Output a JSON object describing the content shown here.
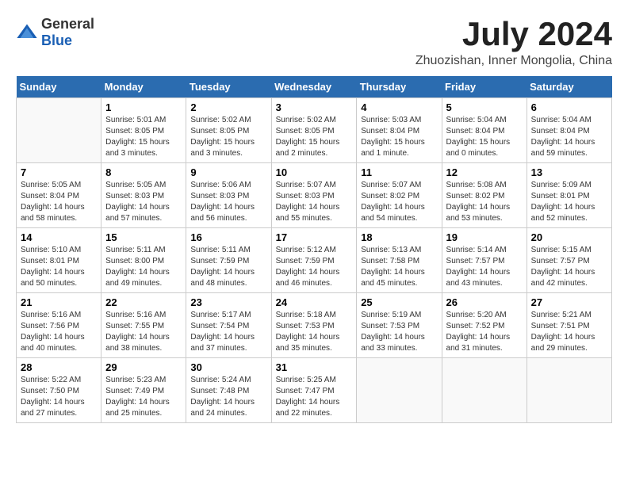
{
  "header": {
    "logo_general": "General",
    "logo_blue": "Blue",
    "month": "July 2024",
    "location": "Zhuozishan, Inner Mongolia, China"
  },
  "weekdays": [
    "Sunday",
    "Monday",
    "Tuesday",
    "Wednesday",
    "Thursday",
    "Friday",
    "Saturday"
  ],
  "weeks": [
    [
      {
        "day": "",
        "info": ""
      },
      {
        "day": "1",
        "info": "Sunrise: 5:01 AM\nSunset: 8:05 PM\nDaylight: 15 hours\nand 3 minutes."
      },
      {
        "day": "2",
        "info": "Sunrise: 5:02 AM\nSunset: 8:05 PM\nDaylight: 15 hours\nand 3 minutes."
      },
      {
        "day": "3",
        "info": "Sunrise: 5:02 AM\nSunset: 8:05 PM\nDaylight: 15 hours\nand 2 minutes."
      },
      {
        "day": "4",
        "info": "Sunrise: 5:03 AM\nSunset: 8:04 PM\nDaylight: 15 hours\nand 1 minute."
      },
      {
        "day": "5",
        "info": "Sunrise: 5:04 AM\nSunset: 8:04 PM\nDaylight: 15 hours\nand 0 minutes."
      },
      {
        "day": "6",
        "info": "Sunrise: 5:04 AM\nSunset: 8:04 PM\nDaylight: 14 hours\nand 59 minutes."
      }
    ],
    [
      {
        "day": "7",
        "info": "Sunrise: 5:05 AM\nSunset: 8:04 PM\nDaylight: 14 hours\nand 58 minutes."
      },
      {
        "day": "8",
        "info": "Sunrise: 5:05 AM\nSunset: 8:03 PM\nDaylight: 14 hours\nand 57 minutes."
      },
      {
        "day": "9",
        "info": "Sunrise: 5:06 AM\nSunset: 8:03 PM\nDaylight: 14 hours\nand 56 minutes."
      },
      {
        "day": "10",
        "info": "Sunrise: 5:07 AM\nSunset: 8:03 PM\nDaylight: 14 hours\nand 55 minutes."
      },
      {
        "day": "11",
        "info": "Sunrise: 5:07 AM\nSunset: 8:02 PM\nDaylight: 14 hours\nand 54 minutes."
      },
      {
        "day": "12",
        "info": "Sunrise: 5:08 AM\nSunset: 8:02 PM\nDaylight: 14 hours\nand 53 minutes."
      },
      {
        "day": "13",
        "info": "Sunrise: 5:09 AM\nSunset: 8:01 PM\nDaylight: 14 hours\nand 52 minutes."
      }
    ],
    [
      {
        "day": "14",
        "info": "Sunrise: 5:10 AM\nSunset: 8:01 PM\nDaylight: 14 hours\nand 50 minutes."
      },
      {
        "day": "15",
        "info": "Sunrise: 5:11 AM\nSunset: 8:00 PM\nDaylight: 14 hours\nand 49 minutes."
      },
      {
        "day": "16",
        "info": "Sunrise: 5:11 AM\nSunset: 7:59 PM\nDaylight: 14 hours\nand 48 minutes."
      },
      {
        "day": "17",
        "info": "Sunrise: 5:12 AM\nSunset: 7:59 PM\nDaylight: 14 hours\nand 46 minutes."
      },
      {
        "day": "18",
        "info": "Sunrise: 5:13 AM\nSunset: 7:58 PM\nDaylight: 14 hours\nand 45 minutes."
      },
      {
        "day": "19",
        "info": "Sunrise: 5:14 AM\nSunset: 7:57 PM\nDaylight: 14 hours\nand 43 minutes."
      },
      {
        "day": "20",
        "info": "Sunrise: 5:15 AM\nSunset: 7:57 PM\nDaylight: 14 hours\nand 42 minutes."
      }
    ],
    [
      {
        "day": "21",
        "info": "Sunrise: 5:16 AM\nSunset: 7:56 PM\nDaylight: 14 hours\nand 40 minutes."
      },
      {
        "day": "22",
        "info": "Sunrise: 5:16 AM\nSunset: 7:55 PM\nDaylight: 14 hours\nand 38 minutes."
      },
      {
        "day": "23",
        "info": "Sunrise: 5:17 AM\nSunset: 7:54 PM\nDaylight: 14 hours\nand 37 minutes."
      },
      {
        "day": "24",
        "info": "Sunrise: 5:18 AM\nSunset: 7:53 PM\nDaylight: 14 hours\nand 35 minutes."
      },
      {
        "day": "25",
        "info": "Sunrise: 5:19 AM\nSunset: 7:53 PM\nDaylight: 14 hours\nand 33 minutes."
      },
      {
        "day": "26",
        "info": "Sunrise: 5:20 AM\nSunset: 7:52 PM\nDaylight: 14 hours\nand 31 minutes."
      },
      {
        "day": "27",
        "info": "Sunrise: 5:21 AM\nSunset: 7:51 PM\nDaylight: 14 hours\nand 29 minutes."
      }
    ],
    [
      {
        "day": "28",
        "info": "Sunrise: 5:22 AM\nSunset: 7:50 PM\nDaylight: 14 hours\nand 27 minutes."
      },
      {
        "day": "29",
        "info": "Sunrise: 5:23 AM\nSunset: 7:49 PM\nDaylight: 14 hours\nand 25 minutes."
      },
      {
        "day": "30",
        "info": "Sunrise: 5:24 AM\nSunset: 7:48 PM\nDaylight: 14 hours\nand 24 minutes."
      },
      {
        "day": "31",
        "info": "Sunrise: 5:25 AM\nSunset: 7:47 PM\nDaylight: 14 hours\nand 22 minutes."
      },
      {
        "day": "",
        "info": ""
      },
      {
        "day": "",
        "info": ""
      },
      {
        "day": "",
        "info": ""
      }
    ]
  ]
}
